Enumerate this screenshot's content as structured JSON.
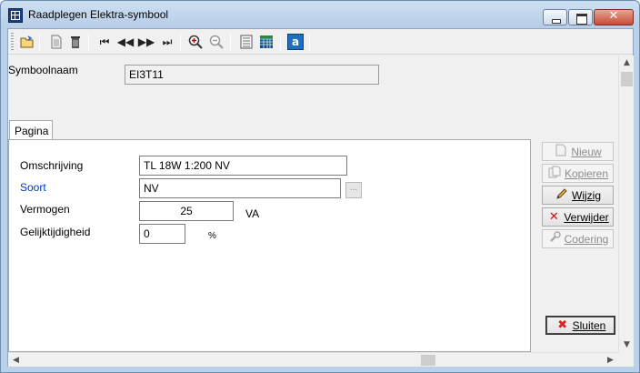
{
  "window": {
    "title": "Raadplegen Elektra-symbool",
    "close_glyph": "✕"
  },
  "toolbar": {
    "icons": [
      "open-folder-icon",
      "document-icon",
      "delete-icon",
      "first-record-icon",
      "previous-record-icon",
      "next-record-icon",
      "last-record-icon",
      "zoom-in-icon",
      "zoom-out-icon",
      "list-view-icon",
      "table-view-icon",
      "text-a-icon"
    ],
    "glyphs": {
      "first": "⏮",
      "prev": "◀◀",
      "next": "▶▶",
      "last": "⏭",
      "a": "a"
    }
  },
  "header": {
    "symbool_label": "Symboolnaam",
    "symbool_value": "EI3T11"
  },
  "tabs": [
    {
      "label": "Pagina"
    }
  ],
  "form": {
    "omschrijving_label": "Omschrijving",
    "omschrijving_value": "TL 18W 1:200 NV",
    "soort_label": "Soort",
    "soort_value": "NV",
    "browse_label": "...",
    "vermogen_label": "Vermogen",
    "vermogen_value": "25",
    "vermogen_unit": "VA",
    "gelijktijdigheid_label": "Gelijktijdigheid",
    "gelijktijdigheid_value": "0",
    "gelijktijdigheid_unit": "%"
  },
  "actions": {
    "nieuw": "Nieuw",
    "kopieren": "Kopieren",
    "wijzig": "Wijzig",
    "verwijder": "Verwijder",
    "codering": "Codering",
    "sluiten": "Sluiten"
  },
  "colors": {
    "link_label": "#0033cc",
    "delete_red": "#d01010"
  }
}
